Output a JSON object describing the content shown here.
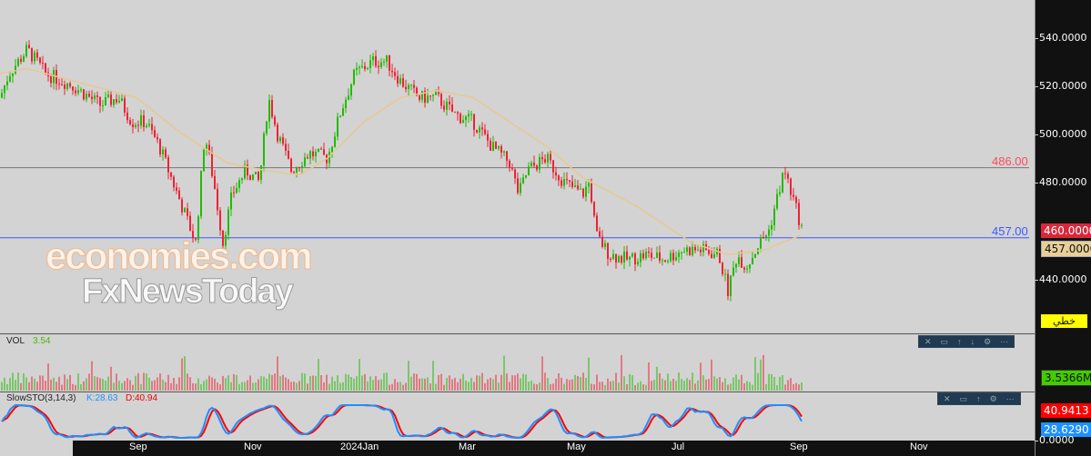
{
  "price_axis": {
    "ticks": [
      "540.0000",
      "520.0000",
      "500.0000",
      "480.0000",
      "440.0000"
    ],
    "ticks_values": [
      540,
      520,
      500,
      480,
      440
    ],
    "current_price": "460.0000",
    "line_price": "457.0000",
    "mode_button": "خطي"
  },
  "levels": [
    {
      "label": "486.00",
      "value": 486,
      "color": "#ff4b5c"
    },
    {
      "label": "457.00",
      "value": 457,
      "color": "#3a5bff"
    }
  ],
  "watermark": {
    "line1": "economies.com",
    "line2": "FxNewsToday"
  },
  "volume": {
    "label": "VOL",
    "value": "3.54",
    "last": "3.5366M"
  },
  "stochastic": {
    "label": "SlowSTO(3,14,3)",
    "k": "K:28.63",
    "d": "D:40.94",
    "d_value": "40.9413",
    "k_value": "28.6290",
    "zero": "0.0000"
  },
  "time_axis": [
    "Sep",
    "Nov",
    "2024Jan",
    "Mar",
    "May",
    "Jul",
    "Sep",
    "Nov"
  ],
  "colors": {
    "up": "#22bb00",
    "down": "#ee2233",
    "ma": "#e8c890",
    "k": "#1e90ff",
    "d": "#ff0000"
  },
  "chart_data": {
    "type": "candlestick",
    "ylim": [
      425,
      548
    ],
    "anchors_x": [
      0,
      10,
      30,
      50,
      80,
      110,
      130,
      145,
      160,
      175,
      190,
      205,
      215,
      225,
      235,
      245,
      255,
      270,
      285,
      295,
      305,
      320,
      340,
      360,
      375,
      390,
      410,
      425,
      440,
      460,
      480,
      500,
      520,
      540,
      560,
      570,
      580,
      600,
      620,
      640,
      648,
      655,
      670,
      690,
      710,
      730,
      750,
      770,
      790,
      800,
      810,
      820,
      835,
      845,
      855,
      862,
      870,
      882
    ],
    "closes": [
      515,
      525,
      535,
      525,
      520,
      512,
      515,
      505,
      505,
      495,
      480,
      465,
      455,
      500,
      480,
      455,
      475,
      485,
      480,
      515,
      500,
      485,
      492,
      490,
      510,
      525,
      530,
      530,
      522,
      515,
      515,
      508,
      505,
      495,
      488,
      475,
      485,
      490,
      480,
      475,
      480,
      458,
      450,
      448,
      450,
      448,
      452,
      452,
      450,
      435,
      450,
      445,
      455,
      460,
      475,
      485,
      475,
      460
    ],
    "ma_x": [
      0,
      30,
      100,
      150,
      200,
      250,
      290,
      330,
      360,
      400,
      440,
      480,
      520,
      560,
      600,
      640,
      700,
      760,
      800,
      840,
      880
    ],
    "ma": [
      525,
      527,
      520,
      515,
      500,
      488,
      485,
      483,
      490,
      505,
      515,
      518,
      515,
      505,
      495,
      482,
      470,
      455,
      450,
      452,
      458
    ]
  }
}
